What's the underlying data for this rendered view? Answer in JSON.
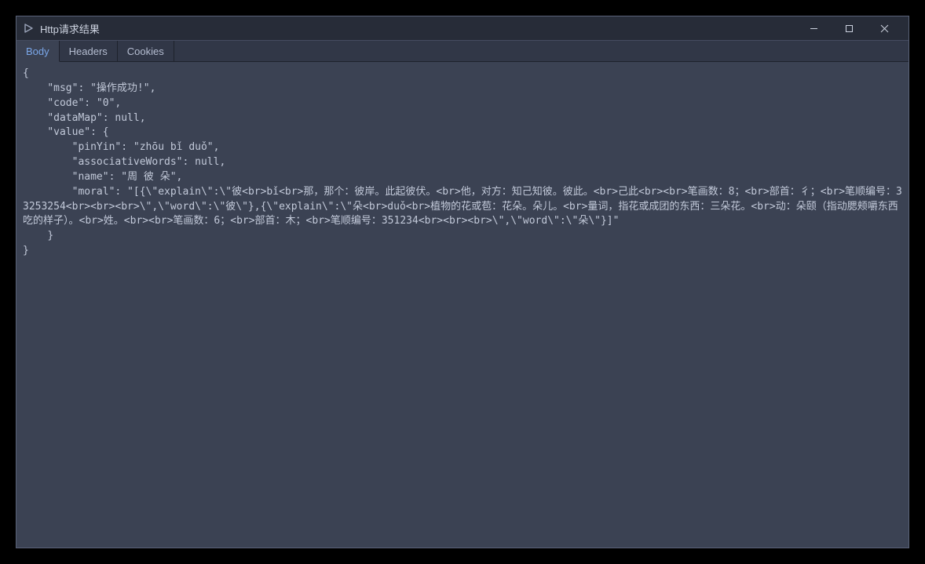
{
  "window": {
    "title": "Http请求结果"
  },
  "tabs": [
    {
      "label": "Body",
      "active": true
    },
    {
      "label": "Headers",
      "active": false
    },
    {
      "label": "Cookies",
      "active": false
    }
  ],
  "body_text": "{\n    \"msg\": \"操作成功!\",\n    \"code\": \"0\",\n    \"dataMap\": null,\n    \"value\": {\n        \"pinYin\": \"zhōu bǐ duǒ\",\n        \"associativeWords\": null,\n        \"name\": \"周 彼 朵\",\n        \"moral\": \"[{\\\"explain\\\":\\\"彼<br>bǐ<br>那，那个：彼岸。此起彼伏。<br>他，对方：知己知彼。彼此。<br>己此<br><br>笔画数：8；<br>部首：彳；<br>笔顺编号：33253254<br><br><br>\\\",\\\"word\\\":\\\"彼\\\"},{\\\"explain\\\":\\\"朵<br>duǒ<br>植物的花或苞：花朵。朵儿。<br>量词，指花或成团的东西：三朵花。<br>动：朵颐（指动腮颊嚼东西吃的样子）。<br>姓。<br><br>笔画数：6；<br>部首：木；<br>笔顺编号：351234<br><br><br>\\\",\\\"word\\\":\\\"朵\\\"}]\"\n    }\n}"
}
